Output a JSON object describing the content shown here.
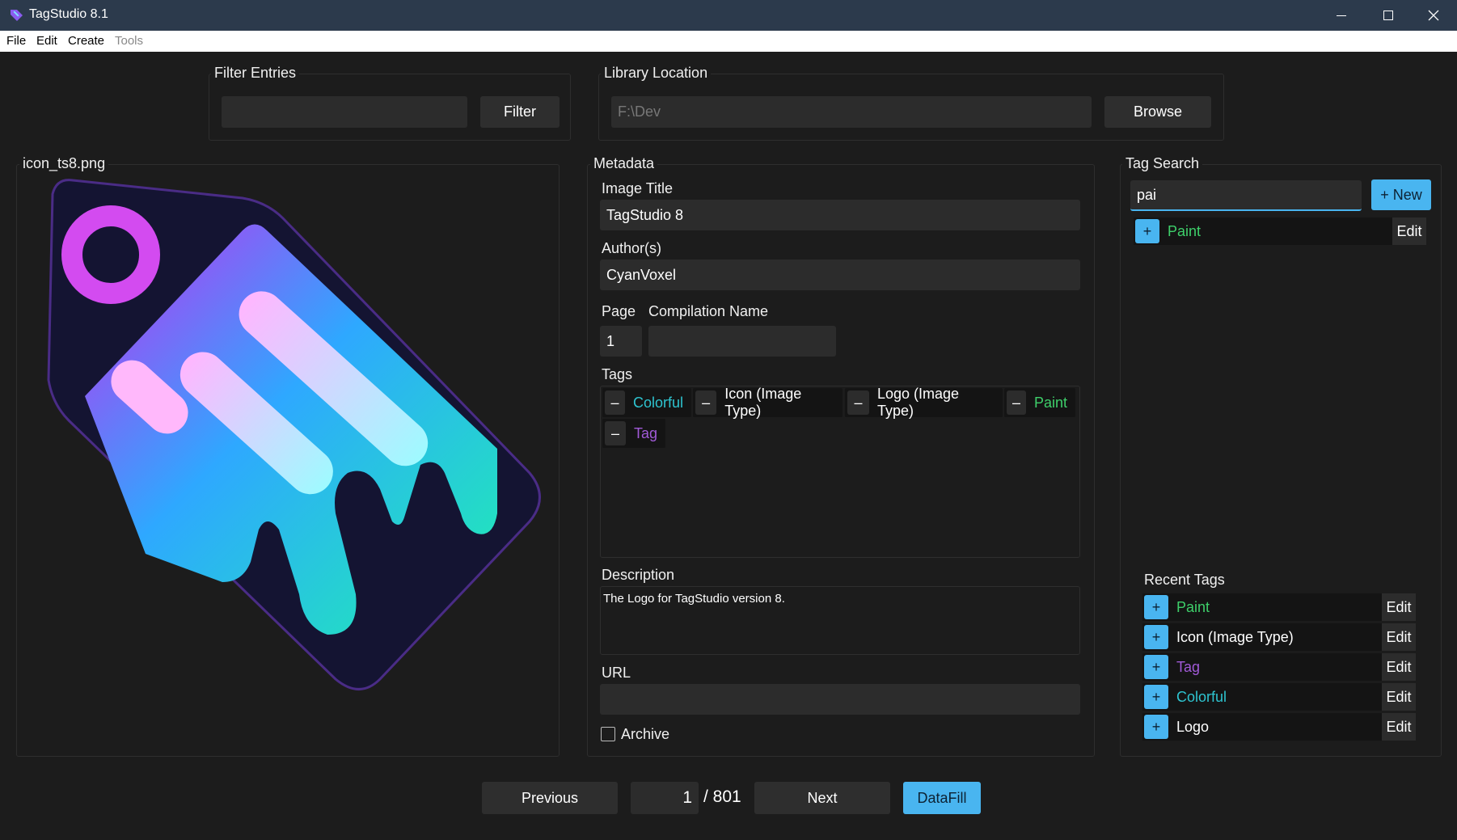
{
  "window": {
    "title": "TagStudio 8.1"
  },
  "menu": {
    "items": [
      "File",
      "Edit",
      "Create",
      "Tools"
    ]
  },
  "filter": {
    "title": "Filter Entries",
    "value": "",
    "button": "Filter"
  },
  "library": {
    "title": "Library Location",
    "path": "F:\\Dev",
    "button": "Browse"
  },
  "preview": {
    "filename": "icon_ts8.png"
  },
  "metadata": {
    "title": "Metadata",
    "image_title_label": "Image Title",
    "image_title_value": "TagStudio 8",
    "authors_label": "Author(s)",
    "authors_value": "CyanVoxel",
    "page_label": "Page",
    "page_value": "1",
    "compilation_label": "Compilation Name",
    "compilation_value": "",
    "tags_label": "Tags",
    "tags": [
      {
        "name": "Colorful",
        "color": "#2ec4d0"
      },
      {
        "name": "Icon (Image Type)",
        "color": "#ffffff"
      },
      {
        "name": "Logo (Image Type)",
        "color": "#ffffff"
      },
      {
        "name": "Paint",
        "color": "#3ecf6a"
      },
      {
        "name": "Tag",
        "color": "#a15ad8"
      }
    ],
    "tag_remove_glyph": "–",
    "description_label": "Description",
    "description_value": "The Logo for TagStudio version 8.",
    "url_label": "URL",
    "url_value": "",
    "archive_label": "Archive"
  },
  "tag_search": {
    "title": "Tag Search",
    "query": "pai",
    "new_button": "+ New",
    "results": [
      {
        "name": "Paint",
        "color": "#3ecf6a"
      }
    ],
    "add_glyph": "+",
    "edit_label": "Edit",
    "recent_title": "Recent Tags",
    "recent": [
      {
        "name": "Paint",
        "color": "#3ecf6a"
      },
      {
        "name": "Icon (Image Type)",
        "color": "#ffffff"
      },
      {
        "name": "Tag",
        "color": "#a15ad8"
      },
      {
        "name": "Colorful",
        "color": "#2ec4d0"
      },
      {
        "name": "Logo",
        "color": "#ffffff"
      }
    ]
  },
  "nav": {
    "previous": "Previous",
    "current_page": "1",
    "total_pages": "/ 801",
    "next": "Next",
    "datafill": "DataFill"
  },
  "colors": {
    "accent": "#49b5f0",
    "background": "#1c1c1c",
    "titlebar": "#2c3a4c"
  }
}
